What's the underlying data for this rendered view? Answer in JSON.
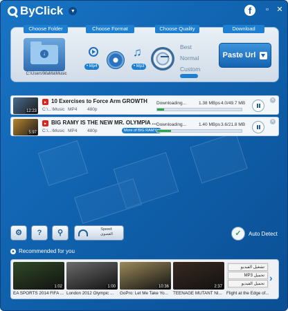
{
  "app": {
    "title": "ByClick"
  },
  "window": {
    "minimize": "▫",
    "close": "✕"
  },
  "panel": {
    "folder_label": "Choose Folder",
    "folder_path": "C:\\Users\\MaMa\\Music",
    "format_label": "Choose Format",
    "format_mp4": "• Mp4",
    "format_mp3": "• Mp3",
    "quality_label": "Choose Quality",
    "quality_best": "Best",
    "quality_normal": "Normal",
    "quality_custom": "Custom",
    "download_label": "Download",
    "paste_url": "Paste Url"
  },
  "downloads": [
    {
      "title": "10 Exercises to Force Arm GROWTH",
      "duration": "12:23",
      "path": "C:\\...\\Music",
      "format": "MP4",
      "quality": "480p",
      "status": "Downloading...",
      "speed": "1.38 MBps",
      "size": "4.0/49.7 MB",
      "progress": 0.08,
      "thumb_color": "#4a6c8f"
    },
    {
      "title": "BIG RAMY IS THE NEW MR. OLYMPIA ...",
      "duration": "5:97",
      "path": "C:\\...\\Music",
      "format": "MP4",
      "quality": "480p",
      "tag": "More of BIG RAMY...",
      "status": "Downloading...",
      "speed": "1.40 MBps",
      "size": "3.6/21.8 MB",
      "progress": 0.16,
      "thumb_color": "#b8862e"
    }
  ],
  "toolbar": {
    "settings_icon": "gear-icon",
    "help": "?",
    "search_icon": "search-icon",
    "speed_label": "Speed:",
    "speed_value": "القصوى"
  },
  "autodetect": {
    "label": "Auto Detect"
  },
  "recommended": {
    "header": "Recommended for you",
    "videos": [
      {
        "title": "EA SPORTS 2014 FIFA ...",
        "duration": "1:02",
        "color": "#2f4a26"
      },
      {
        "title": "London 2012 Olympic ...",
        "duration": "1:00",
        "color": "#6b6b6b"
      },
      {
        "title": "GoPro: Let Me Take Yo...",
        "duration": "10:36",
        "color": "#9c8a5a"
      },
      {
        "title": "TEENAGE MUTANT NI...",
        "duration": "2:37",
        "color": "#3a2a20"
      },
      {
        "title": "Flight at the Edge of...",
        "duration": "",
        "color": "#e8e8e8"
      }
    ],
    "menu_items": [
      "تشغيل الفيديو",
      "تحميل MP3",
      "تحميل الفيديو"
    ]
  },
  "colors": {
    "accent": "#1d7fd1",
    "window": "#1463b2",
    "progress": "#2ea34a"
  }
}
